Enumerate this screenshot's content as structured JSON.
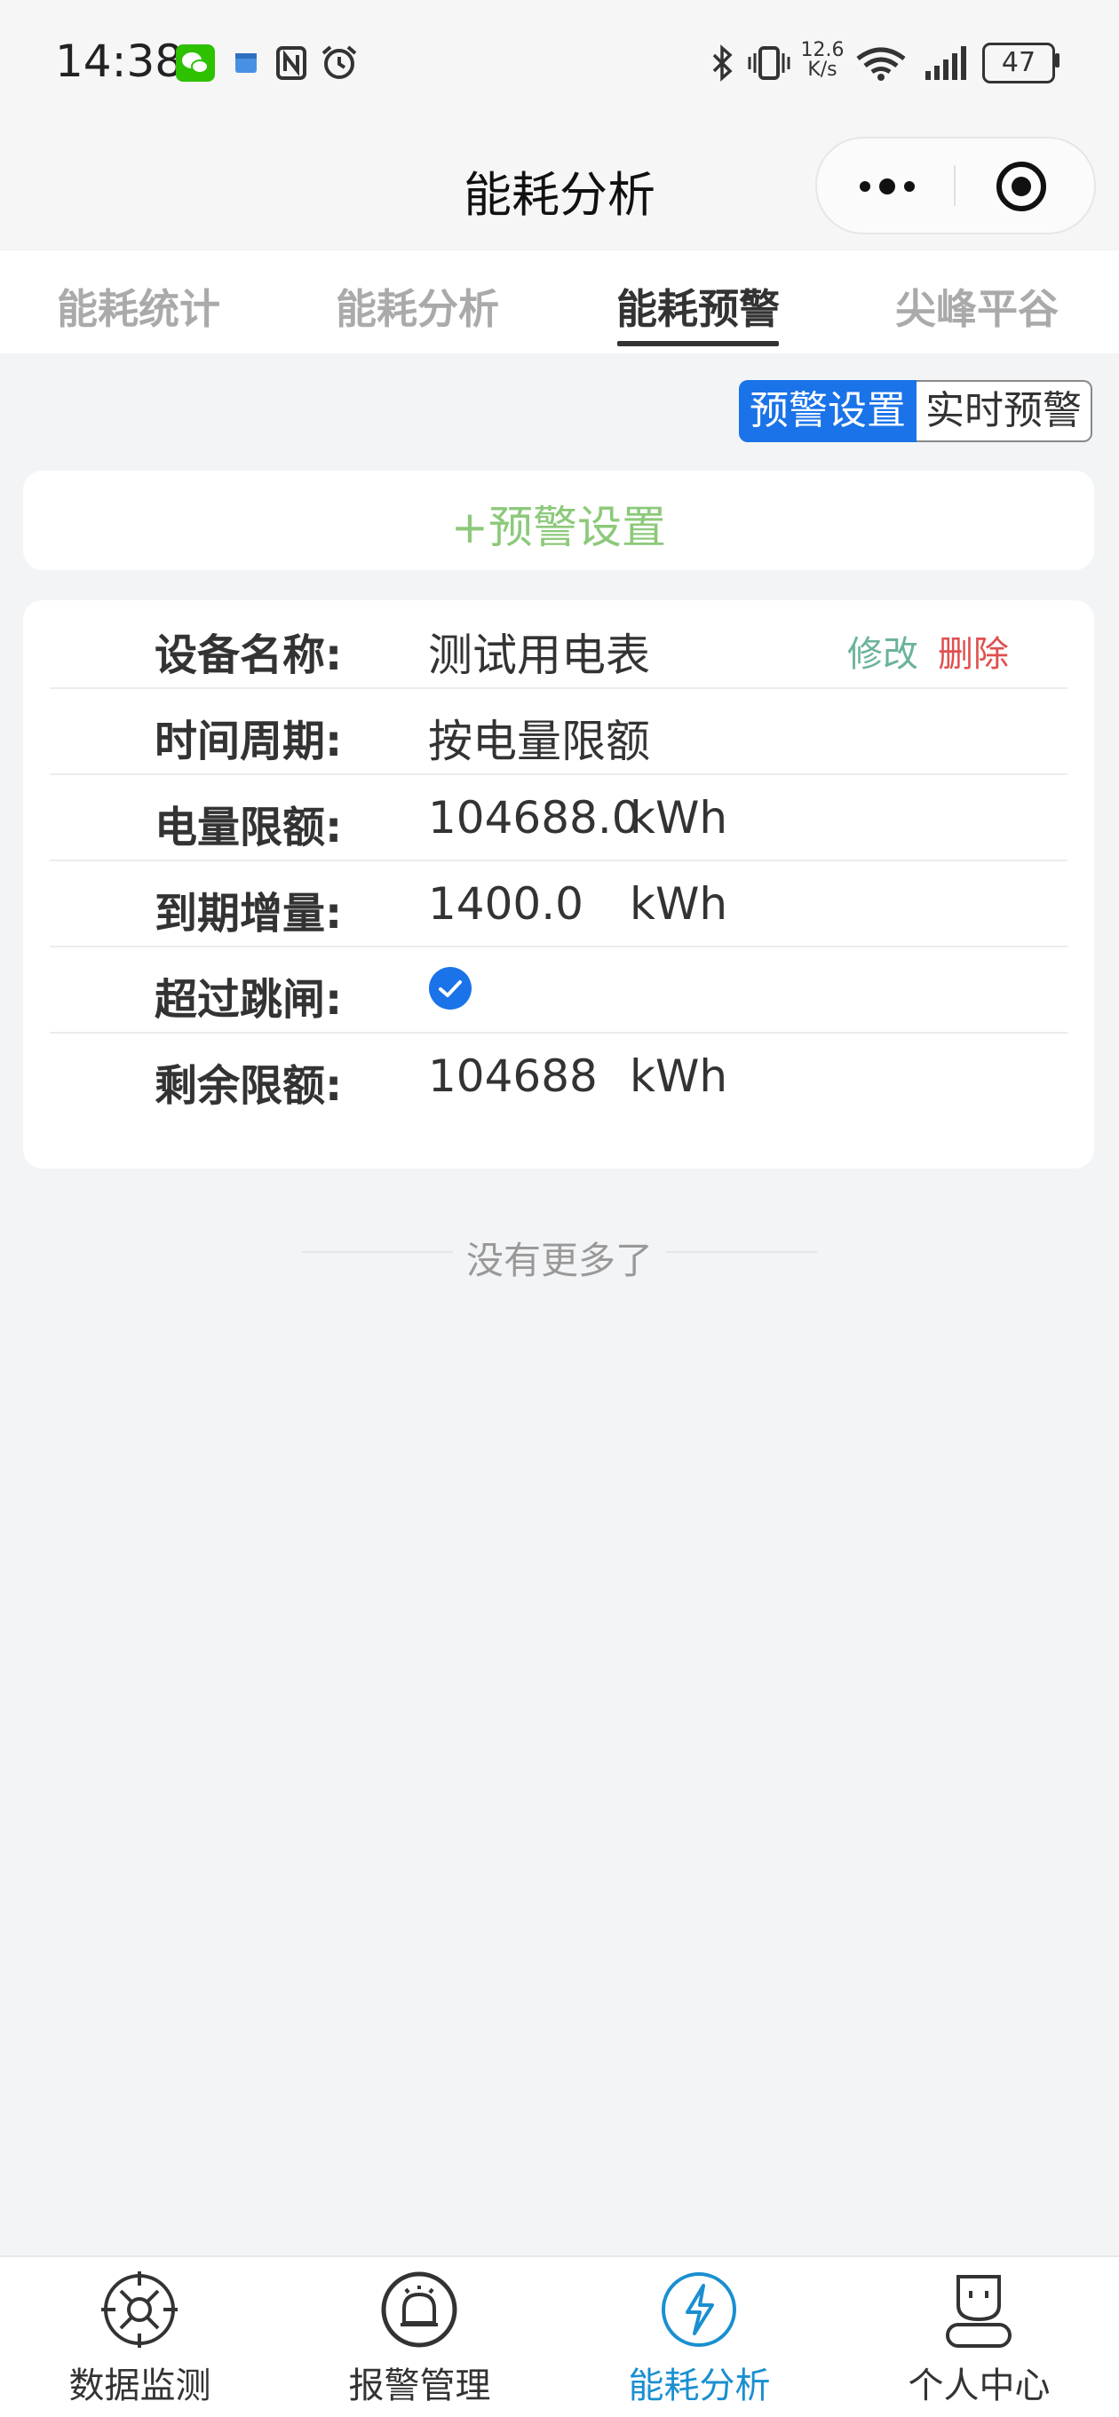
{
  "status_bar": {
    "time": "14:38",
    "net_speed_top": "12.6",
    "net_speed_bottom": "K/s",
    "battery": "47",
    "icons": [
      "wechat-icon",
      "calendar-icon",
      "nfc-icon",
      "alarm-icon",
      "bluetooth-icon",
      "vibrate-icon",
      "wifi-icon",
      "signal-icon",
      "battery-icon"
    ]
  },
  "navbar": {
    "title": "能耗分析"
  },
  "tabs": [
    {
      "label": "能耗统计",
      "active": false
    },
    {
      "label": "能耗分析",
      "active": false
    },
    {
      "label": "能耗预警",
      "active": true
    },
    {
      "label": "尖峰平谷",
      "active": false
    }
  ],
  "segment": {
    "active": "预警设置",
    "inactive": "实时预警"
  },
  "add_button": {
    "label": "+预警设置"
  },
  "record": {
    "edit_label": "修改",
    "delete_label": "删除",
    "rows": [
      {
        "label": "设备名称:",
        "value": "测试用电表",
        "unit": ""
      },
      {
        "label": "时间周期:",
        "value": "按电量限额",
        "unit": ""
      },
      {
        "label": "电量限额:",
        "value": "104688.0",
        "unit": "kWh"
      },
      {
        "label": "到期增量:",
        "value": "1400.0",
        "unit": "kWh"
      },
      {
        "label": "超过跳闸:",
        "value": "",
        "unit": ""
      },
      {
        "label": "剩余限额:",
        "value": "104688",
        "unit": "kWh"
      }
    ],
    "trip_checked": true
  },
  "no_more": "没有更多了",
  "bottom_tabs": [
    {
      "label": "数据监测",
      "icon": "monitor-icon",
      "active": false
    },
    {
      "label": "报警管理",
      "icon": "alarm-light-icon",
      "active": false
    },
    {
      "label": "能耗分析",
      "icon": "lightning-icon",
      "active": true
    },
    {
      "label": "个人中心",
      "icon": "user-icon",
      "active": false
    }
  ],
  "colors": {
    "accent": "#1a73e8",
    "add_green": "#8cc97a",
    "edit": "#6bb39a",
    "delete": "#e05050",
    "tab_active_blue": "#1a8fd0"
  }
}
